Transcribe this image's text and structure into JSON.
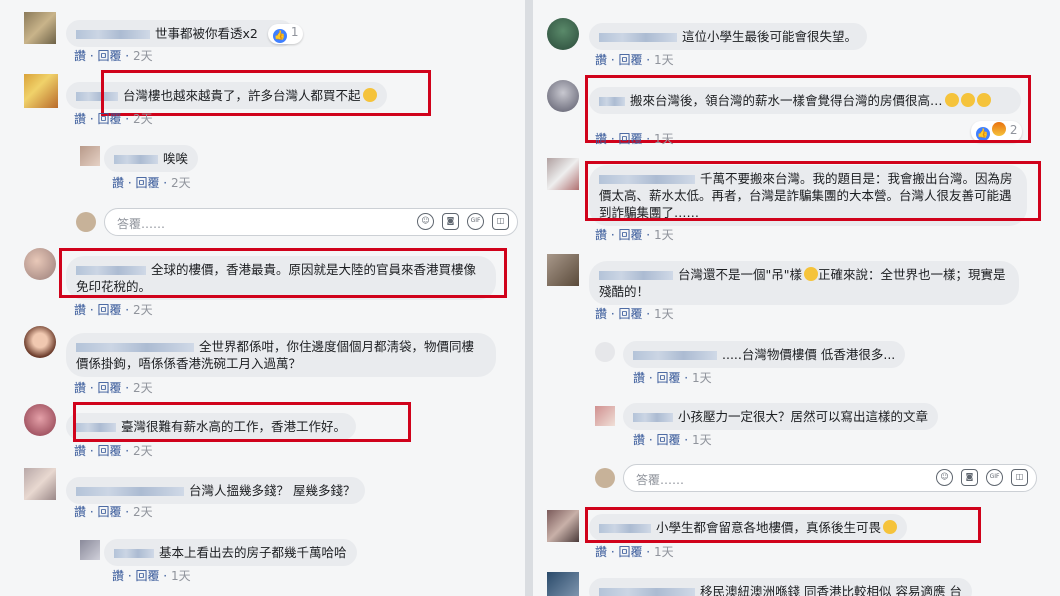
{
  "left": {
    "c1": {
      "text": "世事都被你看透x2",
      "count": "1",
      "like": "讚",
      "reply": "回覆",
      "time": "2天"
    },
    "c2": {
      "text": "台灣樓也越來越貴了，許多台灣人都買不起",
      "like": "讚",
      "reply": "回覆",
      "time": "2天"
    },
    "c2r": {
      "text": "唉唉",
      "like": "讚",
      "reply": "回覆",
      "time": "2天"
    },
    "reply_box": {
      "placeholder": "答覆……"
    },
    "c3": {
      "text": "全球的樓價，香港最貴。原因就是大陸的官員來香港買樓像免印花稅的。",
      "like": "讚",
      "reply": "回覆",
      "time": "2天"
    },
    "c4": {
      "text": "全世界都係咁，你住邊度個個月都淸袋，物價同樓價係掛鉤，唔係係香港洗碗工月入過萬？",
      "like": "讚",
      "reply": "回覆",
      "time": "2天"
    },
    "c5": {
      "text": "臺灣很難有薪水高的工作，香港工作好。",
      "like": "讚",
      "reply": "回覆",
      "time": "2天"
    },
    "c6": {
      "text": "台灣人搵幾多錢？ 屋幾多錢？",
      "like": "讚",
      "reply": "回覆",
      "time": "2天"
    },
    "c6r": {
      "text": "基本上看出去的房子都幾千萬哈哈",
      "like": "讚",
      "reply": "回覆",
      "time": "1天"
    }
  },
  "right": {
    "c1": {
      "text": "這位小學生最後可能會很失望。",
      "like": "讚",
      "reply": "回覆",
      "time": "1天"
    },
    "c2": {
      "text": "搬來台灣後，領台灣的薪水一樣會覺得台灣的房價很高…",
      "count": "2",
      "like": "讚",
      "reply": "回覆",
      "time": "1天"
    },
    "c3": {
      "text": "千萬不要搬來台灣。我的題目是：我會搬出台灣。因為房價太高、薪水太低。再者，台灣是詐騙集團的大本營。台灣人很友善可能遇到詐騙集團了……",
      "like": "讚",
      "reply": "回覆",
      "time": "1天"
    },
    "c4a": {
      "text": "台灣還不是一個\"吊\"樣"
    },
    "c4b": {
      "text": "正確來說：全世界也一樣；現實是殘酷的！"
    },
    "c4": {
      "like": "讚",
      "reply": "回覆",
      "time": "1天"
    },
    "c4r1": {
      "text": ".....台灣物價樓價 低香港很多...",
      "like": "讚",
      "reply": "回覆",
      "time": "1天"
    },
    "c4r2": {
      "text": "小孩壓力一定很大？居然可以寫出這樣的文章",
      "like": "讚",
      "reply": "回覆",
      "time": "1天"
    },
    "reply_box": {
      "placeholder": "答覆……"
    },
    "c5": {
      "text": "小學生都會留意各地樓價，真係後生可畏",
      "like": "讚",
      "reply": "回覆",
      "time": "1天"
    },
    "c6": {
      "text": "移民澳紐澳洲喺錢 同香港比較相似 容易適應 台"
    }
  },
  "icons": {
    "emoji": "☺",
    "camera": "◙",
    "gif": "GIF",
    "sticker": "◫"
  }
}
